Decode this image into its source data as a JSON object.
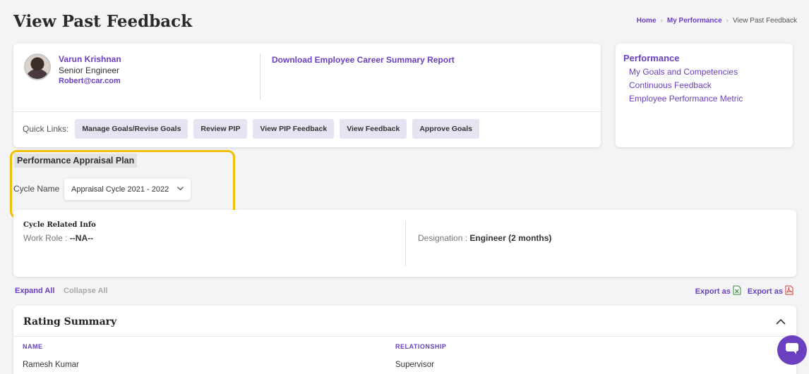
{
  "page": {
    "title": "View Past Feedback"
  },
  "breadcrumb": {
    "home": "Home",
    "sep": "›",
    "parent": "My Performance",
    "current": "View Past Feedback"
  },
  "employee": {
    "name": "Varun Krishnan",
    "title": "Senior Engineer",
    "email": "Robert@car.com",
    "download_link": "Download Employee Career Summary Report"
  },
  "quick_links": {
    "label": "Quick Links:",
    "buttons": [
      "Manage Goals/Revise Goals",
      "Review PIP",
      "View PIP Feedback",
      "View Feedback",
      "Approve Goals"
    ]
  },
  "side_panel": {
    "title": "Performance",
    "links": [
      "My Goals and Competencies",
      "Continuous Feedback",
      "Employee Performance Metric"
    ]
  },
  "appraisal": {
    "section_label": "Performance Appraisal Plan",
    "cycle_label": "Cycle Name",
    "cycle_value": "Appraisal Cycle 2021 - 2022"
  },
  "cycle_info": {
    "title": "Cycle Related Info",
    "work_role_label": "Work Role :",
    "work_role_value": "--NA--",
    "designation_label": "Designation :",
    "designation_value": "Engineer (2 months)"
  },
  "actions": {
    "expand_all": "Expand All",
    "collapse_all": "Collapse All",
    "export_excel": "Export as",
    "export_pdf": "Export as"
  },
  "rating_summary": {
    "title": "Rating Summary",
    "columns": [
      "NAME",
      "RELATIONSHIP"
    ],
    "rows": [
      [
        "Ramesh Kumar",
        "Supervisor"
      ]
    ]
  },
  "colors": {
    "accent": "#6a3fc0",
    "highlight": "#f3c000"
  },
  "icons": {
    "chat": "chat-icon",
    "excel": "excel-icon",
    "pdf": "pdf-icon",
    "chevron": "chevron-down-icon"
  }
}
